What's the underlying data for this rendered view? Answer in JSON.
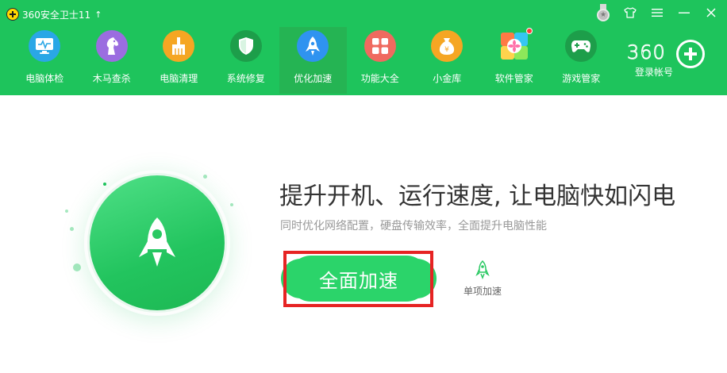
{
  "app": {
    "title": "360安全卫士11",
    "colors": {
      "header": "#1ec45c",
      "active_tab": "#25b453",
      "button": "#2bd46a",
      "highlight": "#e62323"
    }
  },
  "window_controls": [
    {
      "name": "medal-icon"
    },
    {
      "name": "skin-icon"
    },
    {
      "name": "menu-icon"
    },
    {
      "name": "minimize-icon"
    },
    {
      "name": "close-icon"
    }
  ],
  "nav": {
    "items": [
      {
        "label": "电脑体检",
        "icon": "monitor-checkup-icon",
        "color": "#2aa7e6"
      },
      {
        "label": "木马查杀",
        "icon": "horse-icon",
        "color": "#9b6de0"
      },
      {
        "label": "电脑清理",
        "icon": "broom-icon",
        "color": "#f5a623"
      },
      {
        "label": "系统修复",
        "icon": "shield-icon",
        "color": "#1d9e4a"
      },
      {
        "label": "优化加速",
        "icon": "rocket-icon",
        "color": "#2f93f0",
        "active": true
      },
      {
        "label": "功能大全",
        "icon": "grid-icon",
        "color": "#ef6a5f"
      },
      {
        "label": "小金库",
        "icon": "money-bag-icon",
        "color": "#f5a623"
      },
      {
        "label": "软件管家",
        "icon": "software-manager-icon",
        "color": "#ffffff",
        "badge": true
      },
      {
        "label": "游戏管家",
        "icon": "gamepad-icon",
        "color": "#1d9e4a"
      }
    ]
  },
  "account": {
    "brand": "360",
    "login_label": "登录帐号"
  },
  "main": {
    "headline": "提升开机、运行速度, 让电脑快如闪电",
    "subline": "同时优化网络配置，硬盘传输效率，全面提升电脑性能",
    "primary_button": "全面加速",
    "single_accel_label": "单项加速"
  }
}
